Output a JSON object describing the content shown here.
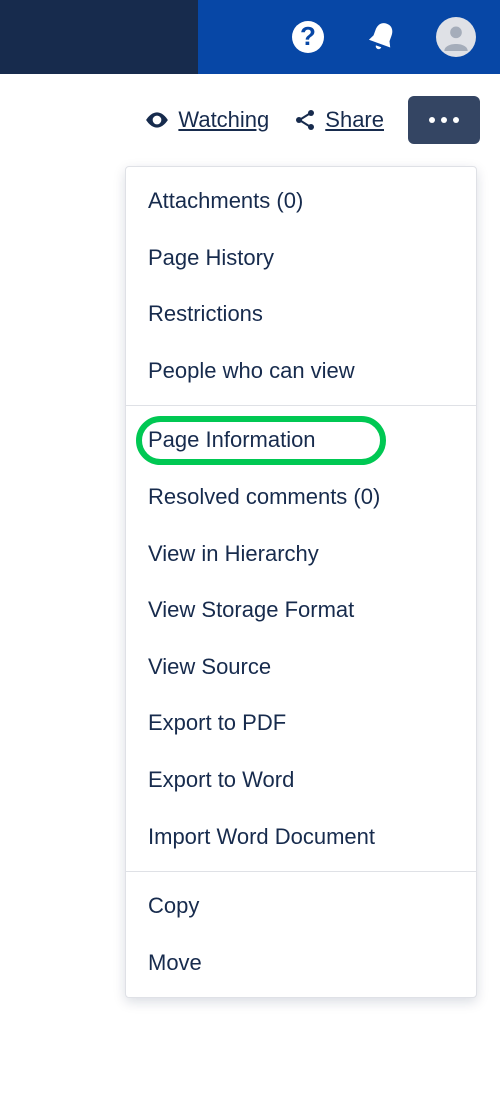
{
  "toolbar": {
    "watching_label": "Watching",
    "share_label": "Share"
  },
  "menu": {
    "group1": [
      "Attachments (0)",
      "Page History",
      "Restrictions",
      "People who can view"
    ],
    "group2": [
      "Page Information",
      "Resolved comments (0)",
      "View in Hierarchy",
      "View Storage Format",
      "View Source",
      "Export to PDF",
      "Export to Word",
      "Import Word Document"
    ],
    "group3": [
      "Copy",
      "Move"
    ]
  },
  "highlighted_item": "Page Information"
}
